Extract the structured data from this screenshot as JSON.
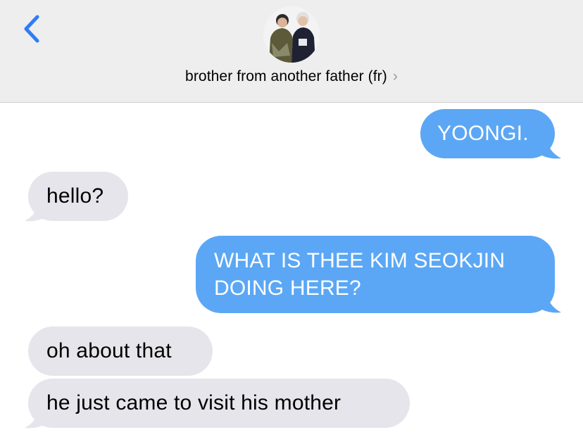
{
  "header": {
    "contact_name": "brother from another father (fr)",
    "chevron": "›",
    "back_icon": "chevron-left-icon",
    "avatar_icon": "contact-photo"
  },
  "colors": {
    "header_bg": "#eeeeee",
    "sent_bubble": "#5ba7f5",
    "received_bubble": "#e6e5eb",
    "accent": "#2f7cf6"
  },
  "messages": [
    {
      "direction": "sent",
      "text": "YOONGI."
    },
    {
      "direction": "received",
      "text": "hello?"
    },
    {
      "direction": "sent",
      "text": "WHAT IS THEE KIM SEOKJIN DOING HERE?"
    },
    {
      "direction": "received",
      "text": "oh about that"
    },
    {
      "direction": "received",
      "text": "he just came to visit his mother"
    }
  ]
}
